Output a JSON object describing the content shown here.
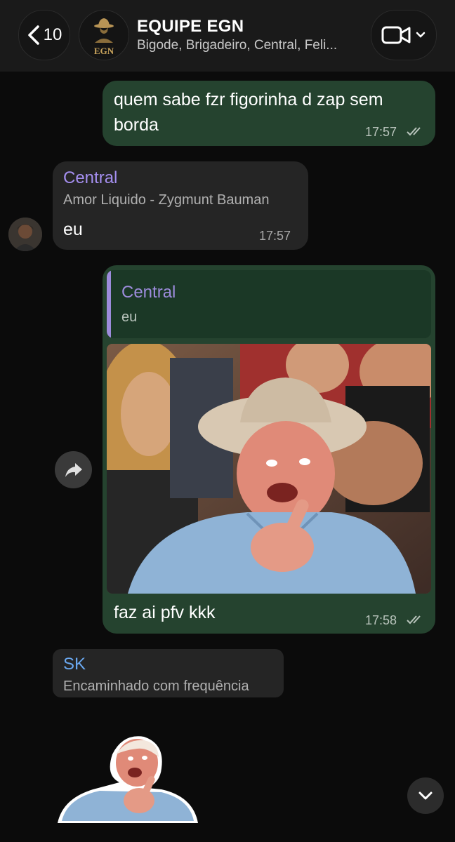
{
  "header": {
    "back_count": "10",
    "group_logo_text": "EGN",
    "title": "EQUIPE EGN",
    "members": "Bigode, Brigadeiro, Central, Feli..."
  },
  "messages": [
    {
      "direction": "outgoing",
      "text_line1": "quem sabe fzr figorinha d zap sem",
      "text_line2": "borda",
      "time": "17:57",
      "status": "read"
    },
    {
      "direction": "incoming",
      "sender": "Central",
      "sender_color": "#a58ff0",
      "sender_status": "Amor Liquido - Zygmunt Bauman",
      "text": "eu",
      "time": "17:57"
    },
    {
      "direction": "outgoing",
      "quote_sender": "Central",
      "quote_text": "eu",
      "media": "photo",
      "caption": "faz ai pfv kkk",
      "time": "17:58",
      "status": "read"
    },
    {
      "direction": "incoming",
      "sender": "SK",
      "sender_color": "#6aa8f0",
      "forwarded_label": "Encaminhado com frequência",
      "media": "sticker"
    }
  ],
  "colors": {
    "background": "#0b0b0b",
    "outgoing_bubble": "#25432f",
    "incoming_bubble": "#252525",
    "quote_accent": "#9d8cdc"
  },
  "icons": [
    "chevron-left-icon",
    "video-camera-icon",
    "chevron-down-icon",
    "share-arrow-icon",
    "double-check-icon"
  ]
}
